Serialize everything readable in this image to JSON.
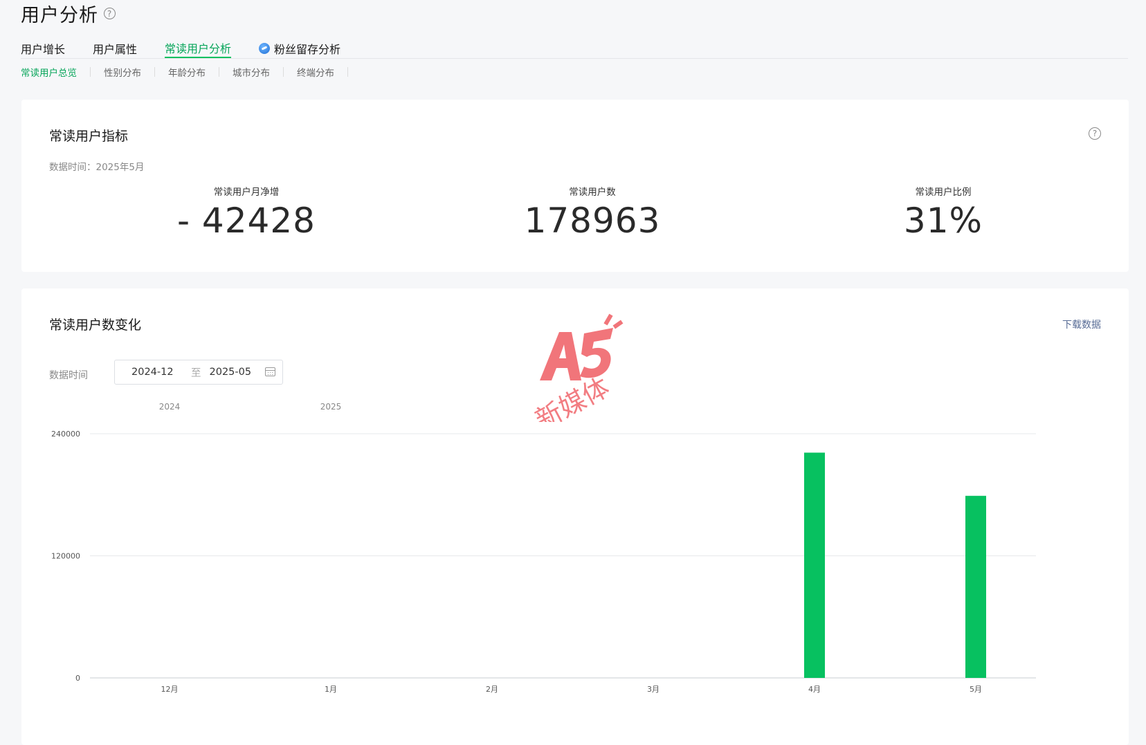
{
  "page": {
    "title": "用户分析"
  },
  "main_tabs": [
    {
      "label": "用户增长"
    },
    {
      "label": "用户属性"
    },
    {
      "label": "常读用户分析",
      "active": true
    },
    {
      "label": "粉丝留存分析",
      "icon": "fans-badge-icon"
    }
  ],
  "sub_tabs": [
    {
      "label": "常读用户总览",
      "active": true
    },
    {
      "label": "性别分布"
    },
    {
      "label": "年龄分布"
    },
    {
      "label": "城市分布"
    },
    {
      "label": "终端分布"
    }
  ],
  "metrics_card": {
    "title": "常读用户指标",
    "data_time": "数据时间：2025年5月",
    "metrics": [
      {
        "label": "常读用户月净增",
        "value": "- 42428"
      },
      {
        "label": "常读用户数",
        "value": "178963"
      },
      {
        "label": "常读用户比例",
        "value": "31%"
      }
    ]
  },
  "trend_card": {
    "title": "常读用户数变化",
    "download_label": "下载数据",
    "data_time_label": "数据时间",
    "range_start": "2024-12",
    "range_sep": "至",
    "range_end": "2025-05"
  },
  "watermark": {
    "brand": "A5",
    "text": "新媒体"
  },
  "colors": {
    "accent": "#07c160",
    "link": "#576b95"
  },
  "chart_data": {
    "type": "bar",
    "year_labels": [
      {
        "label": "2024",
        "category": "12月"
      },
      {
        "label": "2025",
        "category": "1月"
      }
    ],
    "categories": [
      "12月",
      "1月",
      "2月",
      "3月",
      "4月",
      "5月"
    ],
    "values": [
      0,
      0,
      0,
      0,
      221391,
      178963
    ],
    "yticks": [
      0,
      120000,
      240000
    ],
    "ylim": [
      0,
      240000
    ],
    "grid": true,
    "bar_color": "#07c160"
  }
}
